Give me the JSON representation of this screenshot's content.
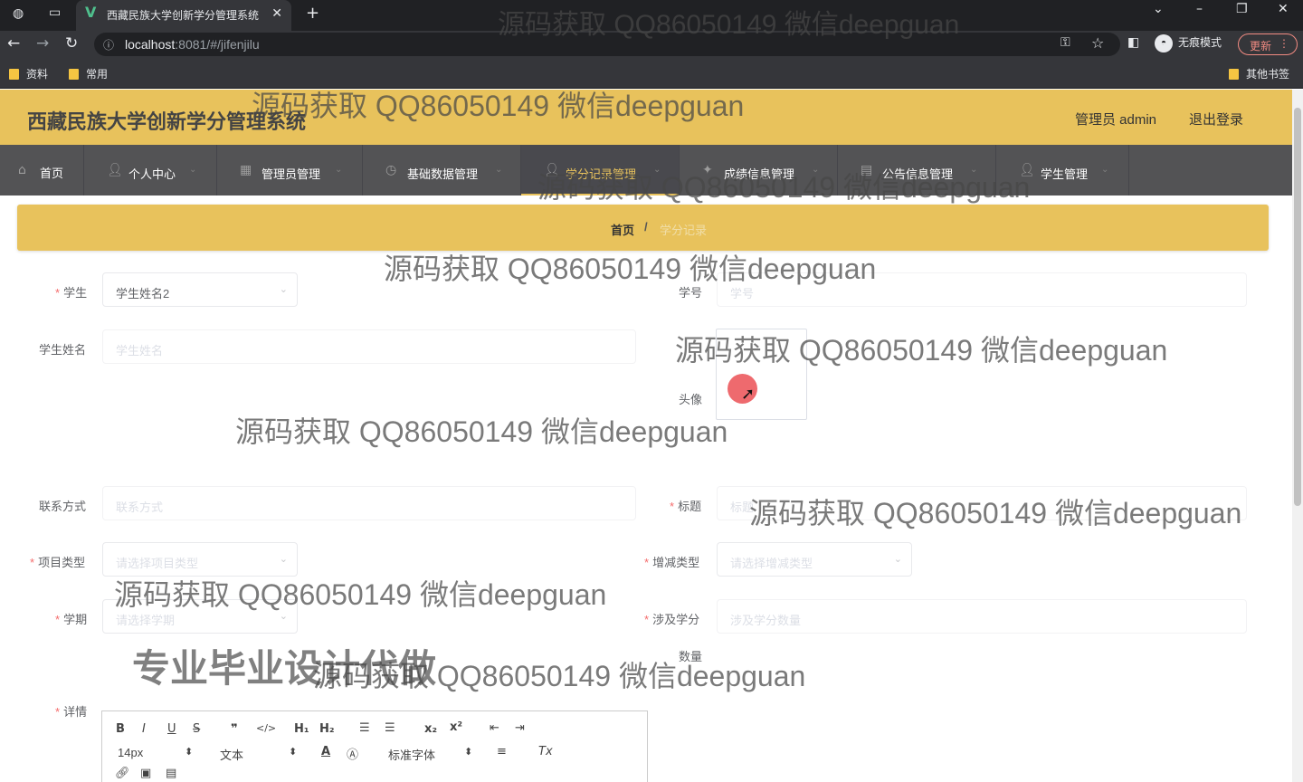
{
  "browser": {
    "tab_title": "西藏民族大学创新学分管理系统",
    "tab_favicon": "V",
    "url_host": "localhost",
    "url_rest": ":8081/#/jifenjilu",
    "incognito_label": "无痕模式",
    "update_label": "更新",
    "bookmarks": [
      "资料",
      "常用"
    ],
    "other_bookmarks": "其他书签"
  },
  "header": {
    "title": "西藏民族大学创新学分管理系统",
    "admin": "管理员 admin",
    "logout": "退出登录"
  },
  "nav": {
    "items": [
      {
        "label": "首页",
        "icon": "home-icon"
      },
      {
        "label": "个人中心",
        "icon": "user-icon"
      },
      {
        "label": "管理员管理",
        "icon": "grid-icon"
      },
      {
        "label": "基础数据管理",
        "icon": "clock-icon"
      },
      {
        "label": "学分记录管理",
        "icon": "user-icon"
      },
      {
        "label": "成绩信息管理",
        "icon": "star-icon"
      },
      {
        "label": "公告信息管理",
        "icon": "doc-icon"
      },
      {
        "label": "学生管理",
        "icon": "user-icon"
      }
    ],
    "active_index": 4
  },
  "breadcrumb": {
    "home": "首页",
    "separator": "/",
    "current": "学分记录"
  },
  "form": {
    "student_label": "学生",
    "student_value": "学生姓名2",
    "student_no_label": "学号",
    "student_no_placeholder": "学号",
    "student_name_label": "学生姓名",
    "student_name_placeholder": "学生姓名",
    "avatar_label": "头像",
    "contact_label": "联系方式",
    "contact_placeholder": "联系方式",
    "title_label": "标题",
    "title_placeholder": "标题",
    "project_type_label": "项目类型",
    "project_type_placeholder": "请选择项目类型",
    "change_type_label": "增减类型",
    "change_type_placeholder": "请选择增减类型",
    "semester_label": "学期",
    "semester_placeholder": "请选择学期",
    "credits_label": "涉及学分",
    "credits_label_2": "数量",
    "credits_placeholder": "涉及学分数量",
    "detail_label": "详情"
  },
  "editor": {
    "font_size": "14px",
    "paragraph": "文本",
    "font_family": "标准字体"
  },
  "watermarks": [
    "源码获取 QQ86050149 微信deepguan"
  ],
  "watermark_big": "专业毕业设计代做",
  "colors": {
    "accent": "#e8c25c",
    "nav_bg": "#535355",
    "required": "#f56c6c"
  }
}
